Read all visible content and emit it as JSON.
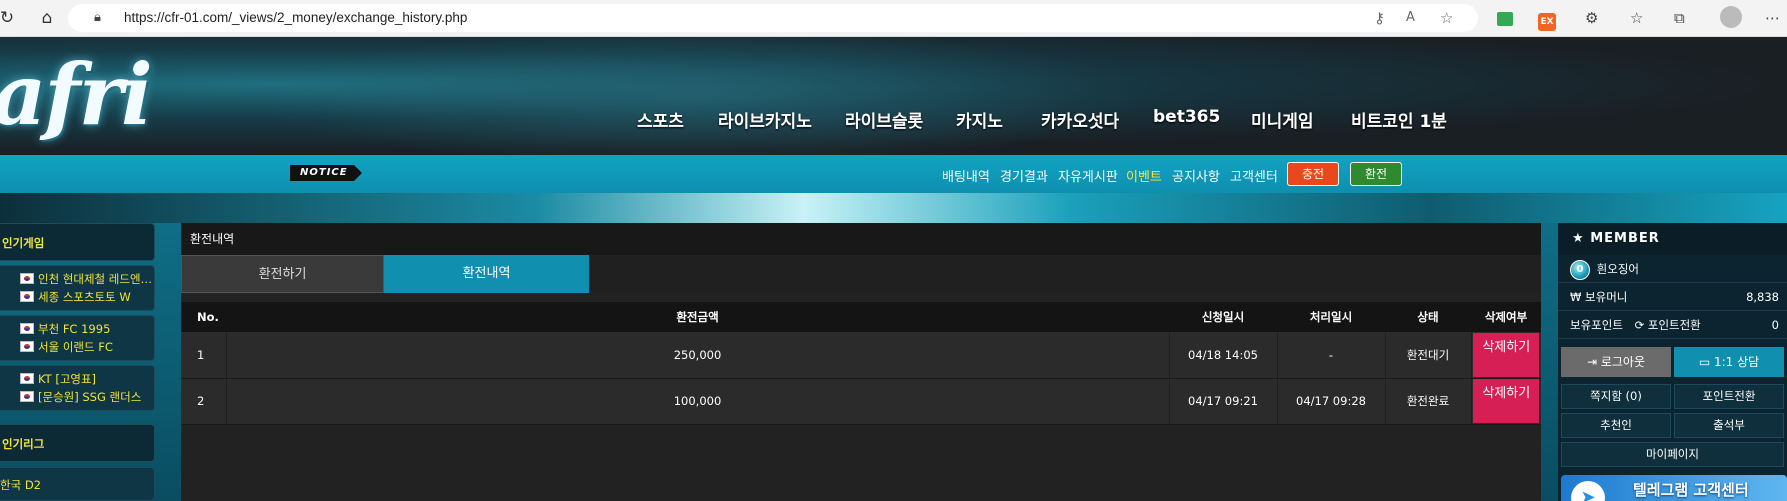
{
  "browser": {
    "url": "https://cfr-01.com/_views/2_money/exchange_history.php",
    "ext_badge": "EX"
  },
  "site": {
    "logo_text": "afri",
    "main_nav": [
      "스포츠",
      "라이브카지노",
      "라이브슬롯",
      "카지노",
      "카카오섯다",
      "bet365",
      "미니게임",
      "비트코인 1분"
    ],
    "notice_label": "NOTICE",
    "sub_nav": [
      "배팅내역",
      "경기결과",
      "자유게시판",
      "이벤트",
      "공지사항",
      "고객센터"
    ],
    "deposit_button": "충전",
    "withdraw_button": "환전"
  },
  "left_sidebar": {
    "popular_games_title": "인기게임",
    "games": [
      {
        "home": "인천 현대제철 레드엔…",
        "away": "세종 스포츠토토 W"
      },
      {
        "home": "부천 FC 1995",
        "away": "서울 이랜드 FC"
      },
      {
        "home": "KT [고영표]",
        "away": "[문승원] SSG 랜더스"
      }
    ],
    "popular_leagues_title": "인기리그",
    "leagues": [
      "한국 D2"
    ]
  },
  "main": {
    "title": "환전내역",
    "tabs": [
      {
        "label": "환전하기",
        "active": false
      },
      {
        "label": "환전내역",
        "active": true
      }
    ],
    "table": {
      "headers": [
        "No.",
        "환전금액",
        "신청일시",
        "처리일시",
        "상태",
        "삭제여부"
      ],
      "rows": [
        {
          "no": "1",
          "amount": "250,000",
          "requested": "04/18 14:05",
          "processed": "-",
          "status": "환전대기",
          "delete_label": "삭제하기"
        },
        {
          "no": "2",
          "amount": "100,000",
          "requested": "04/17 09:21",
          "processed": "04/17 09:28",
          "status": "환전완료",
          "delete_label": "삭제하기"
        }
      ]
    }
  },
  "right_sidebar": {
    "header": "MEMBER",
    "level": "0",
    "username": "흰오징어",
    "money_label": "보유머니",
    "money_value": "8,838",
    "point_label": "보유포인트",
    "point_convert_label": "포인트전환",
    "point_value": "0",
    "logout_button": "로그아웃",
    "consult_button": "1:1 상담",
    "links": [
      "쪽지함 (0)",
      "포인트전환",
      "추천인",
      "출석부"
    ],
    "mypage": "마이페이지",
    "telegram_label": "텔레그램 고객센터"
  },
  "colors": {
    "accent_teal": "#118fae",
    "delete_pink": "#d51f55",
    "deposit_orange": "#e8481c",
    "withdraw_green": "#2f8a2f",
    "highlight_yellow": "#f3e33a"
  }
}
